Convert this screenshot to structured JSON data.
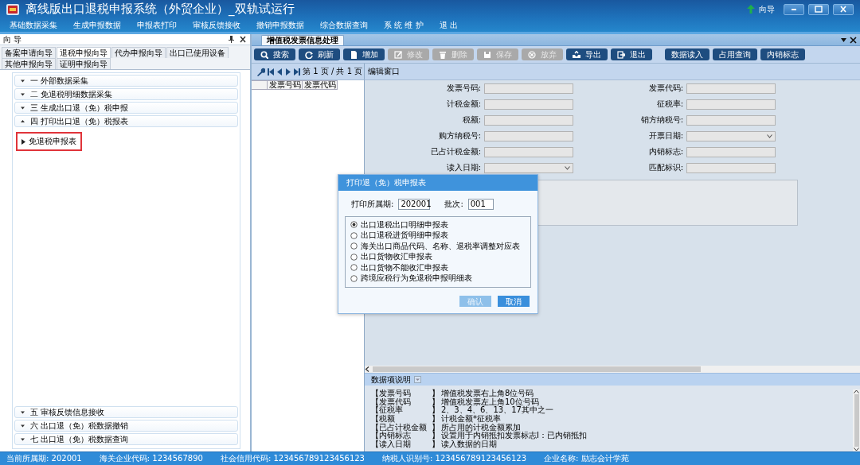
{
  "window": {
    "title": "离线版出口退税申报系统（外贸企业）_双轨试运行",
    "guide_label": "向导"
  },
  "menu": [
    "基础数据采集",
    "生成申报数据",
    "申报表打印",
    "审核反馈接收",
    "撤销申报数据",
    "综合数据查询",
    "系 统 维 护",
    "退 出"
  ],
  "nav_panel": {
    "title": "向 导",
    "tabs": [
      {
        "label": "备案申请向导",
        "selected": false
      },
      {
        "label": "退税申报向导",
        "selected": true
      },
      {
        "label": "代办申报向导",
        "selected": false
      },
      {
        "label": "出口已使用设备",
        "selected": false
      },
      {
        "label": "其他申报向导",
        "selected": false
      },
      {
        "label": "证明申报向导",
        "selected": false
      }
    ],
    "sections": [
      {
        "label": "一 外部数据采集",
        "expanded": false
      },
      {
        "label": "二 免退税明细数据采集",
        "expanded": false
      },
      {
        "label": "三 生成出口退（免）税申报",
        "expanded": false
      },
      {
        "label": "四 打印出口退（免）税报表",
        "expanded": true,
        "children": [
          {
            "label": "免退税申报表",
            "selected": true
          }
        ]
      }
    ],
    "bottom_sections": [
      {
        "label": "五 审核反馈信息接收",
        "expanded": false
      },
      {
        "label": "六 出口退（免）税数据撤销",
        "expanded": false
      },
      {
        "label": "七 出口退（免）税数据查询",
        "expanded": false
      }
    ]
  },
  "document_tab": "增值税发票信息处理",
  "toolbar": [
    {
      "label": "搜索",
      "kind": "icon",
      "disabled": false
    },
    {
      "label": "刷新",
      "kind": "icon",
      "disabled": false
    },
    {
      "label": "增加",
      "kind": "icon",
      "disabled": false
    },
    {
      "label": "修改",
      "kind": "icon",
      "disabled": true
    },
    {
      "label": "删除",
      "kind": "icon",
      "disabled": true
    },
    {
      "label": "保存",
      "kind": "icon",
      "disabled": true
    },
    {
      "label": "放弃",
      "kind": "icon",
      "disabled": true
    },
    {
      "label": "导出",
      "kind": "icon",
      "disabled": false
    },
    {
      "label": "退出",
      "kind": "icon",
      "disabled": false
    },
    {
      "label": "数据读入",
      "kind": "text",
      "disabled": false
    },
    {
      "label": "占用查询",
      "kind": "text",
      "disabled": false
    },
    {
      "label": "内销标志",
      "kind": "text",
      "disabled": false
    }
  ],
  "pager": "第 1 页 / 共 1 页",
  "list": {
    "columns": [
      "发票号码",
      "发票代码"
    ]
  },
  "editor": {
    "title": "编辑窗口",
    "fields": [
      {
        "label": "发票号码:",
        "kind": "text"
      },
      {
        "label": "发票代码:",
        "kind": "text"
      },
      {
        "label": "计税金额:",
        "kind": "text"
      },
      {
        "label": "征税率:",
        "kind": "text"
      },
      {
        "label": "税额:",
        "kind": "text"
      },
      {
        "label": "销方纳税号:",
        "kind": "text"
      },
      {
        "label": "购方纳税号:",
        "kind": "text"
      },
      {
        "label": "开票日期:",
        "kind": "select"
      },
      {
        "label": "已占计税金额:",
        "kind": "text"
      },
      {
        "label": "内销标志:",
        "kind": "text"
      },
      {
        "label": "读入日期:",
        "kind": "select"
      },
      {
        "label": "匹配标识:",
        "kind": "text"
      }
    ]
  },
  "dialog": {
    "title": "打印退（免）税申报表",
    "period_label": "打印所属期:",
    "period_value": "202001",
    "batch_label": "批次:",
    "batch_value": "001",
    "options": [
      {
        "label": "出口退税出口明细申报表",
        "selected": true
      },
      {
        "label": "出口退税进货明细申报表",
        "selected": false
      },
      {
        "label": "海关出口商品代码、名称、退税率调整对应表",
        "selected": false
      },
      {
        "label": "出口货物收汇申报表",
        "selected": false
      },
      {
        "label": "出口货物不能收汇申报表",
        "selected": false
      },
      {
        "label": "跨境应税行为免退税申报明细表",
        "selected": false
      }
    ],
    "buttons": [
      {
        "label": "确认",
        "disabled": true
      },
      {
        "label": "取消",
        "disabled": false
      }
    ]
  },
  "help": {
    "title": "数据项说明",
    "items": [
      {
        "term": "【发票号码",
        "mark": "】",
        "description": "增值税发票右上角8位号码"
      },
      {
        "term": "【发票代码",
        "mark": "】",
        "description": "增值税发票左上角10位号码"
      },
      {
        "term": "【征税率",
        "mark": "】",
        "description": "2、3、4、6、13、17其中之一"
      },
      {
        "term": "【税额",
        "mark": "】",
        "description": "计税金额*征税率"
      },
      {
        "term": "【已占计税金额",
        "mark": "】",
        "description": "所占用的计税金额累加"
      },
      {
        "term": "【内销标志",
        "mark": "】",
        "description": "设置用于内销抵扣发票标志I：已内销抵扣"
      },
      {
        "term": "【读入日期",
        "mark": "】",
        "description": "读入数据的日期"
      }
    ]
  },
  "status_bar": [
    "当前所属期: 202001",
    "海关企业代码: 1234567890",
    "社会信用代码: 123456789123456123",
    "纳税人识别号: 123456789123456123",
    "企业名称: 励志会计学苑"
  ]
}
